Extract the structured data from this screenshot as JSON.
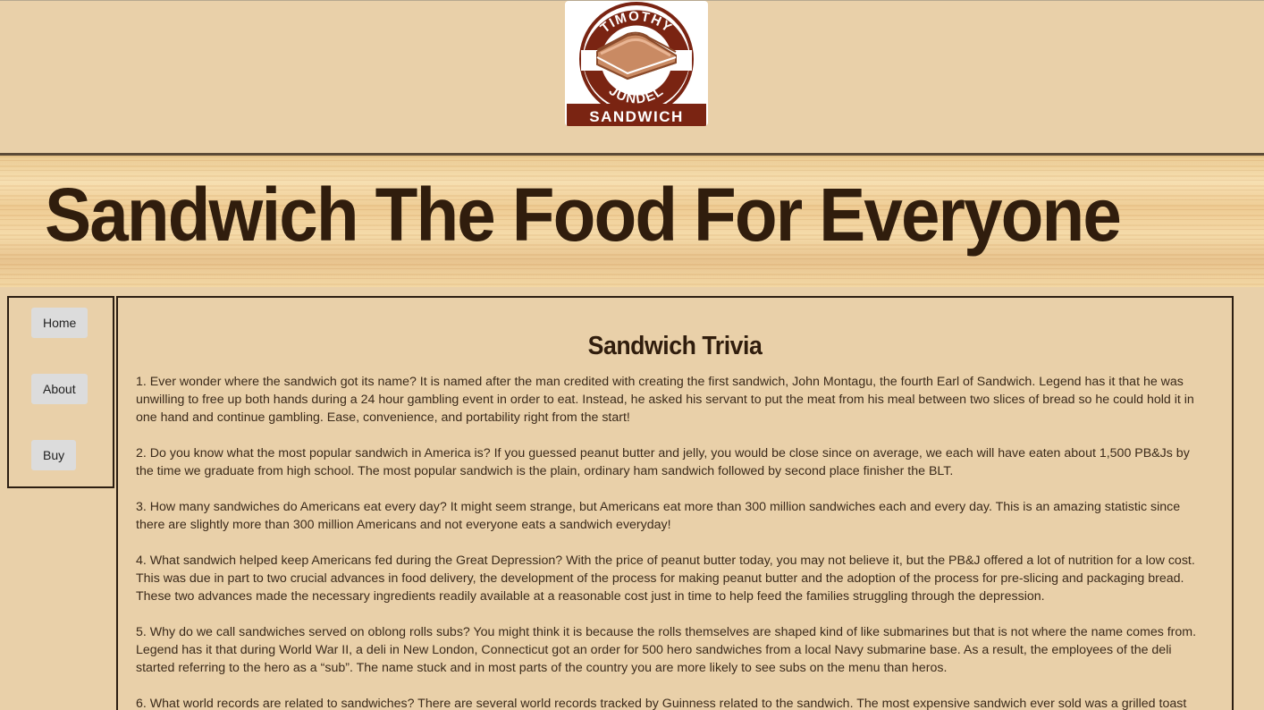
{
  "logo": {
    "top_text": "TIMOTHY",
    "bottom_text": "JUNDEL",
    "wordmark": "SANDWICH",
    "colors": {
      "brand": "#7a2412",
      "bread": "#c98a63",
      "white": "#ffffff"
    }
  },
  "banner": {
    "title": "Sandwich The Food For Everyone"
  },
  "nav": {
    "home": "Home",
    "about": "About",
    "buy": "Buy"
  },
  "main": {
    "title": "Sandwich Trivia",
    "items": [
      "1. Ever wonder where the sandwich got its name? It is named after the man credited with creating the first sandwich, John Montagu, the fourth Earl of Sandwich. Legend has it that he was unwilling to free up both hands during a 24 hour gambling event in order to eat. Instead, he asked his servant to put the meat from his meal between two slices of bread so he could hold it in one hand and continue gambling. Ease, convenience, and portability right from the start!",
      "2. Do you know what the most popular sandwich in America is? If you guessed peanut butter and jelly, you would be close since on average, we each will have eaten about 1,500 PB&Js by the time we graduate from high school. The most popular sandwich is the plain, ordinary ham sandwich followed by second place finisher the BLT.",
      "3. How many sandwiches do Americans eat every day? It might seem strange, but Americans eat more than 300 million sandwiches each and every day. This is an amazing statistic since there are slightly more than 300 million Americans and not everyone eats a sandwich everyday!",
      "4. What sandwich helped keep Americans fed during the Great Depression? With the price of peanut butter today, you may not believe it, but the PB&J offered a lot of nutrition for a low cost. This was due in part to two crucial advances in food delivery, the development of the process for making peanut butter and the adoption of the process for pre-slicing and packaging bread. These two advances made the necessary ingredients readily available at a reasonable cost just in time to help feed the families struggling through the depression.",
      "5. Why do we call sandwiches served on oblong rolls subs? You might think it is because the rolls themselves are shaped kind of like submarines but that is not where the name comes from. Legend has it that during World War II, a deli in New London, Connecticut got an order for 500 hero sandwiches from a local Navy submarine base. As a result, the employees of the deli started referring to the hero as a “sub”. The name stuck and in most parts of the country you are more likely to see subs on the menu than heros.",
      "6. What world records are related to sandwiches? There are several world records tracked by Guinness related to the sandwich. The most expensive sandwich ever sold was a grilled toast"
    ]
  }
}
